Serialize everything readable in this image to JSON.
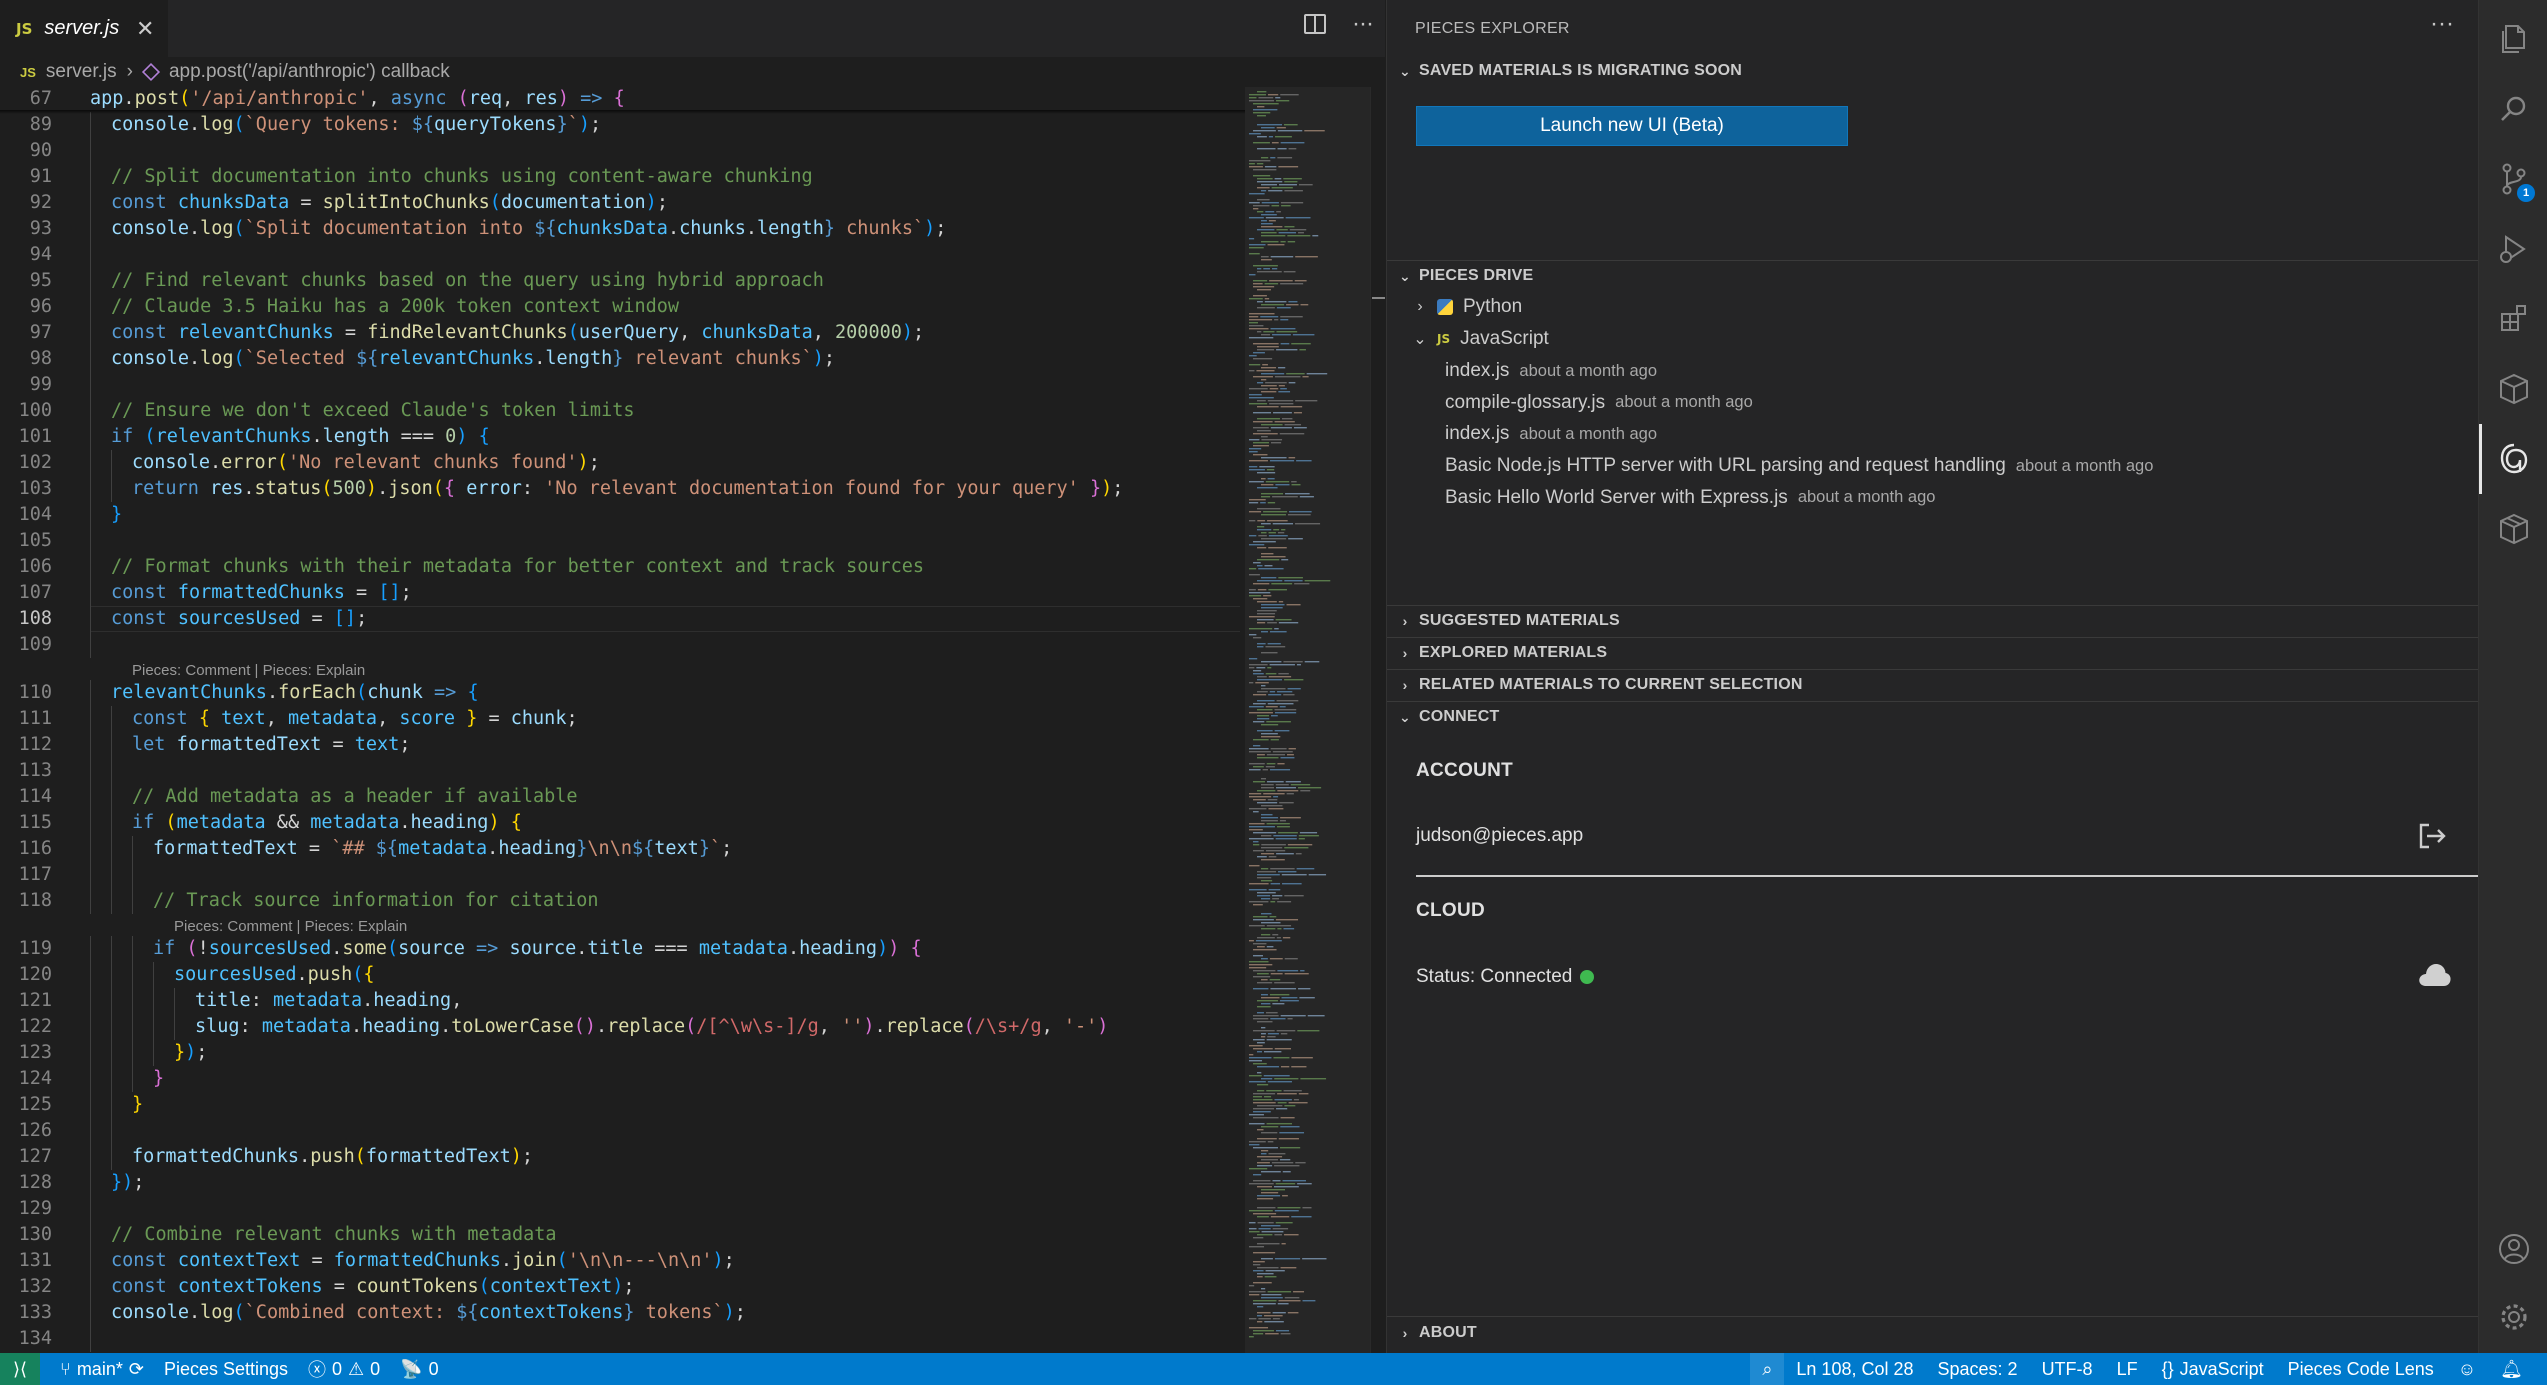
{
  "editor": {
    "tab": {
      "icon_label": "JS",
      "name": "server.js",
      "close": "✕"
    },
    "tab_actions": {
      "split_icon": "split-editor-icon",
      "more": "···"
    },
    "breadcrumb": {
      "file_icon_label": "JS",
      "file": "server.js",
      "separator": "›",
      "symbol": "app.post('/api/anthropic') callback"
    },
    "active_line": "108",
    "lines": [
      {
        "n": "67",
        "html": "<span class='var'>app</span>.<span class='fn'>post</span><span class='brk'>(</span><span class='str'>'/api/anthropic'</span>, <span class='kw'>async</span> <span class='brk2'>(</span><span class='var'>req</span>, <span class='var'>res</span><span class='brk2'>)</span> <span class='kw'>=&gt;</span> <span class='brk2'>{</span>",
        "indent": 0
      },
      {
        "n": "89",
        "html": "<span class='var'>console</span>.<span class='fn'>log</span><span class='brk3'>(</span><span class='str'>`Query tokens: </span><span class='kw'>${</span><span class='var'>queryTokens</span><span class='kw'>}</span><span class='str'>`</span><span class='brk3'>)</span>;",
        "indent": 1
      },
      {
        "n": "90",
        "html": "",
        "indent": 1
      },
      {
        "n": "91",
        "html": "<span class='cm'>// Split documentation into chunks using content-aware chunking</span>",
        "indent": 1
      },
      {
        "n": "92",
        "html": "<span class='kw'>const</span> <span class='cst'>chunksData</span> = <span class='fn'>splitIntoChunks</span><span class='brk3'>(</span><span class='var'>documentation</span><span class='brk3'>)</span>;",
        "indent": 1
      },
      {
        "n": "93",
        "html": "<span class='var'>console</span>.<span class='fn'>log</span><span class='brk3'>(</span><span class='str'>`Split documentation into </span><span class='kw'>${</span><span class='cst'>chunksData</span>.<span class='var'>chunks</span>.<span class='var'>length</span><span class='kw'>}</span><span class='str'> chunks`</span><span class='brk3'>)</span>;",
        "indent": 1
      },
      {
        "n": "94",
        "html": "",
        "indent": 1
      },
      {
        "n": "95",
        "html": "<span class='cm'>// Find relevant chunks based on the query using hybrid approach</span>",
        "indent": 1
      },
      {
        "n": "96",
        "html": "<span class='cm'>// Claude 3.5 Haiku has a 200k token context window</span>",
        "indent": 1
      },
      {
        "n": "97",
        "html": "<span class='kw'>const</span> <span class='cst'>relevantChunks</span> = <span class='fn'>findRelevantChunks</span><span class='brk3'>(</span><span class='var'>userQuery</span>, <span class='cst'>chunksData</span>, <span class='num'>200000</span><span class='brk3'>)</span>;",
        "indent": 1
      },
      {
        "n": "98",
        "html": "<span class='var'>console</span>.<span class='fn'>log</span><span class='brk3'>(</span><span class='str'>`Selected </span><span class='kw'>${</span><span class='cst'>relevantChunks</span>.<span class='var'>length</span><span class='kw'>}</span><span class='str'> relevant chunks`</span><span class='brk3'>)</span>;",
        "indent": 1
      },
      {
        "n": "99",
        "html": "",
        "indent": 1
      },
      {
        "n": "100",
        "html": "<span class='cm'>// Ensure we don't exceed Claude's token limits</span>",
        "indent": 1
      },
      {
        "n": "101",
        "html": "<span class='kw'>if</span> <span class='brk3'>(</span><span class='cst'>relevantChunks</span>.<span class='var'>length</span> === <span class='num'>0</span><span class='brk3'>)</span> <span class='brk3'>{</span>",
        "indent": 1
      },
      {
        "n": "102",
        "html": "<span class='var'>console</span>.<span class='fn'>error</span><span class='brk'>(</span><span class='str'>'No relevant chunks found'</span><span class='brk'>)</span>;",
        "indent": 2
      },
      {
        "n": "103",
        "html": "<span class='kw'>return</span> <span class='var'>res</span>.<span class='fn'>status</span><span class='brk'>(</span><span class='num'>500</span><span class='brk'>)</span>.<span class='fn'>json</span><span class='brk'>(</span><span class='brk2'>{</span> <span class='var'>error</span>: <span class='str'>'No relevant documentation found for your query'</span> <span class='brk2'>}</span><span class='brk'>)</span>;",
        "indent": 2
      },
      {
        "n": "104",
        "html": "<span class='brk3'>}</span>",
        "indent": 1
      },
      {
        "n": "105",
        "html": "",
        "indent": 1
      },
      {
        "n": "106",
        "html": "<span class='cm'>// Format chunks with their metadata for better context and track sources</span>",
        "indent": 1
      },
      {
        "n": "107",
        "html": "<span class='kw'>const</span> <span class='cst'>formattedChunks</span> = <span class='brk3'>[]</span>;",
        "indent": 1
      },
      {
        "n": "108",
        "html": "<span class='kw'>const</span> <span class='cst'>sourcesUsed</span> = <span class='brk3'>[]</span>;",
        "indent": 1
      },
      {
        "n": "109",
        "html": "",
        "indent": 1
      },
      {
        "lens": "Pieces: Comment | Pieces: Explain",
        "lens_indent": 1
      },
      {
        "n": "110",
        "html": "<span class='cst'>relevantChunks</span>.<span class='fn'>forEach</span><span class='brk3'>(</span><span class='var'>chunk</span> <span class='kw'>=&gt;</span> <span class='brk3'>{</span>",
        "indent": 1
      },
      {
        "n": "111",
        "html": "<span class='kw'>const</span> <span class='brk'>{</span> <span class='cst'>text</span>, <span class='cst'>metadata</span>, <span class='cst'>score</span> <span class='brk'>}</span> = <span class='var'>chunk</span>;",
        "indent": 2
      },
      {
        "n": "112",
        "html": "<span class='kw'>let</span> <span class='var'>formattedText</span> = <span class='cst'>text</span>;",
        "indent": 2
      },
      {
        "n": "113",
        "html": "",
        "indent": 2
      },
      {
        "n": "114",
        "html": "<span class='cm'>// Add metadata as a header if available</span>",
        "indent": 2
      },
      {
        "n": "115",
        "html": "<span class='kw'>if</span> <span class='brk'>(</span><span class='cst'>metadata</span> &amp;&amp; <span class='cst'>metadata</span>.<span class='var'>heading</span><span class='brk'>)</span> <span class='brk'>{</span>",
        "indent": 2
      },
      {
        "n": "116",
        "html": "<span class='var'>formattedText</span> = <span class='str'>`## </span><span class='kw'>${</span><span class='cst'>metadata</span>.<span class='var'>heading</span><span class='kw'>}</span><span class='str'>\\n\\n</span><span class='kw'>${</span><span class='var'>text</span><span class='kw'>}</span><span class='str'>`</span>;",
        "indent": 3
      },
      {
        "n": "117",
        "html": "",
        "indent": 3
      },
      {
        "n": "118",
        "html": "<span class='cm'>// Track source information for citation</span>",
        "indent": 3
      },
      {
        "lens": "Pieces: Comment | Pieces: Explain",
        "lens_indent": 3
      },
      {
        "n": "119",
        "html": "<span class='kw'>if</span> <span class='brk2'>(</span>!<span class='cst'>sourcesUsed</span>.<span class='fn'>some</span><span class='brk3'>(</span><span class='var'>source</span> <span class='kw'>=&gt;</span> <span class='var'>source</span>.<span class='var'>title</span> === <span class='cst'>metadata</span>.<span class='var'>heading</span><span class='brk3'>)</span><span class='brk2'>)</span> <span class='brk2'>{</span>",
        "indent": 3
      },
      {
        "n": "120",
        "html": "<span class='cst'>sourcesUsed</span>.<span class='fn'>push</span><span class='brk3'>(</span><span class='brk'>{</span>",
        "indent": 4
      },
      {
        "n": "121",
        "html": "<span class='var'>title</span>: <span class='cst'>metadata</span>.<span class='var'>heading</span>,",
        "indent": 5
      },
      {
        "n": "122",
        "html": "<span class='var'>slug</span>: <span class='cst'>metadata</span>.<span class='var'>heading</span>.<span class='fn'>toLowerCase</span><span class='brk2'>()</span>.<span class='fn'>replace</span><span class='brk2'>(</span><span class='rx'>/[^\\w\\s-]/g</span>, <span class='str'>''</span><span class='brk2'>)</span>.<span class='fn'>replace</span><span class='brk2'>(</span><span class='rx'>/\\s+/g</span>, <span class='str'>'-'</span><span class='brk2'>)</span>",
        "indent": 5
      },
      {
        "n": "123",
        "html": "<span class='brk'>}</span><span class='brk3'>)</span>;",
        "indent": 4
      },
      {
        "n": "124",
        "html": "<span class='brk2'>}</span>",
        "indent": 3
      },
      {
        "n": "125",
        "html": "<span class='brk'>}</span>",
        "indent": 2
      },
      {
        "n": "126",
        "html": "",
        "indent": 2
      },
      {
        "n": "127",
        "html": "<span class='var'>formattedChunks</span>.<span class='fn'>push</span><span class='brk'>(</span><span class='var'>formattedText</span><span class='brk'>)</span>;",
        "indent": 2
      },
      {
        "n": "128",
        "html": "<span class='brk3'>}</span><span class='brk3'>)</span>;",
        "indent": 1
      },
      {
        "n": "129",
        "html": "",
        "indent": 1
      },
      {
        "n": "130",
        "html": "<span class='cm'>// Combine relevant chunks with metadata</span>",
        "indent": 1
      },
      {
        "n": "131",
        "html": "<span class='kw'>const</span> <span class='cst'>contextText</span> = <span class='cst'>formattedChunks</span>.<span class='fn'>join</span><span class='brk3'>(</span><span class='str'>'\\n\\n---\\n\\n'</span><span class='brk3'>)</span>;",
        "indent": 1
      },
      {
        "n": "132",
        "html": "<span class='kw'>const</span> <span class='cst'>contextTokens</span> = <span class='fn'>countTokens</span><span class='brk3'>(</span><span class='cst'>contextText</span><span class='brk3'>)</span>;",
        "indent": 1
      },
      {
        "n": "133",
        "html": "<span class='var'>console</span>.<span class='fn'>log</span><span class='brk3'>(</span><span class='str'>`Combined context: </span><span class='kw'>${</span><span class='cst'>contextTokens</span><span class='kw'>}</span><span class='str'> tokens`</span><span class='brk3'>)</span>;",
        "indent": 1
      },
      {
        "n": "134",
        "html": "",
        "indent": 1
      }
    ]
  },
  "panel": {
    "title": "PIECES EXPLORER",
    "more": "···",
    "migrating": {
      "title": "SAVED MATERIALS IS MIGRATING SOON",
      "button": "Launch new UI (Beta)"
    },
    "drive": {
      "title": "PIECES DRIVE",
      "python": "Python",
      "javascript": "JavaScript",
      "js_icon_label": "JS",
      "items": [
        {
          "name": "index.js",
          "meta": "about a month ago"
        },
        {
          "name": "compile-glossary.js",
          "meta": "about a month ago"
        },
        {
          "name": "index.js",
          "meta": "about a month ago"
        },
        {
          "name": "Basic Node.js HTTP server with URL parsing and request handling",
          "meta": "about a month ago"
        },
        {
          "name": "Basic Hello World Server with Express.js",
          "meta": "about a month ago"
        }
      ]
    },
    "suggested": "SUGGESTED MATERIALS",
    "explored": "EXPLORED MATERIALS",
    "related": "RELATED MATERIALS TO CURRENT SELECTION",
    "connect": {
      "title": "CONNECT",
      "account_heading": "ACCOUNT",
      "email": "judson@pieces.app",
      "cloud_heading": "CLOUD",
      "status": "Status: Connected",
      "status_color": "#3fb950"
    },
    "about": "ABOUT"
  },
  "activity_bar": {
    "items": [
      "explorer-icon",
      "search-icon",
      "source-control-icon",
      "run-debug-icon",
      "extensions-icon",
      "package-icon",
      "pieces-icon",
      "cube-icon"
    ],
    "scm_badge": "1",
    "bottom": [
      "account-icon",
      "settings-gear-icon"
    ]
  },
  "statusbar": {
    "remote": "⟩⟨",
    "branch": "main*",
    "sync": "⟳",
    "pieces_settings": "Pieces Settings",
    "errors": "0",
    "warnings": "0",
    "ports": "0",
    "cursor": "Ln 108, Col 28",
    "spaces": "Spaces: 2",
    "encoding": "UTF-8",
    "eol": "LF",
    "language": "JavaScript",
    "language_brace": "{}",
    "code_lens": "Pieces Code Lens",
    "accent": "#007acc"
  }
}
